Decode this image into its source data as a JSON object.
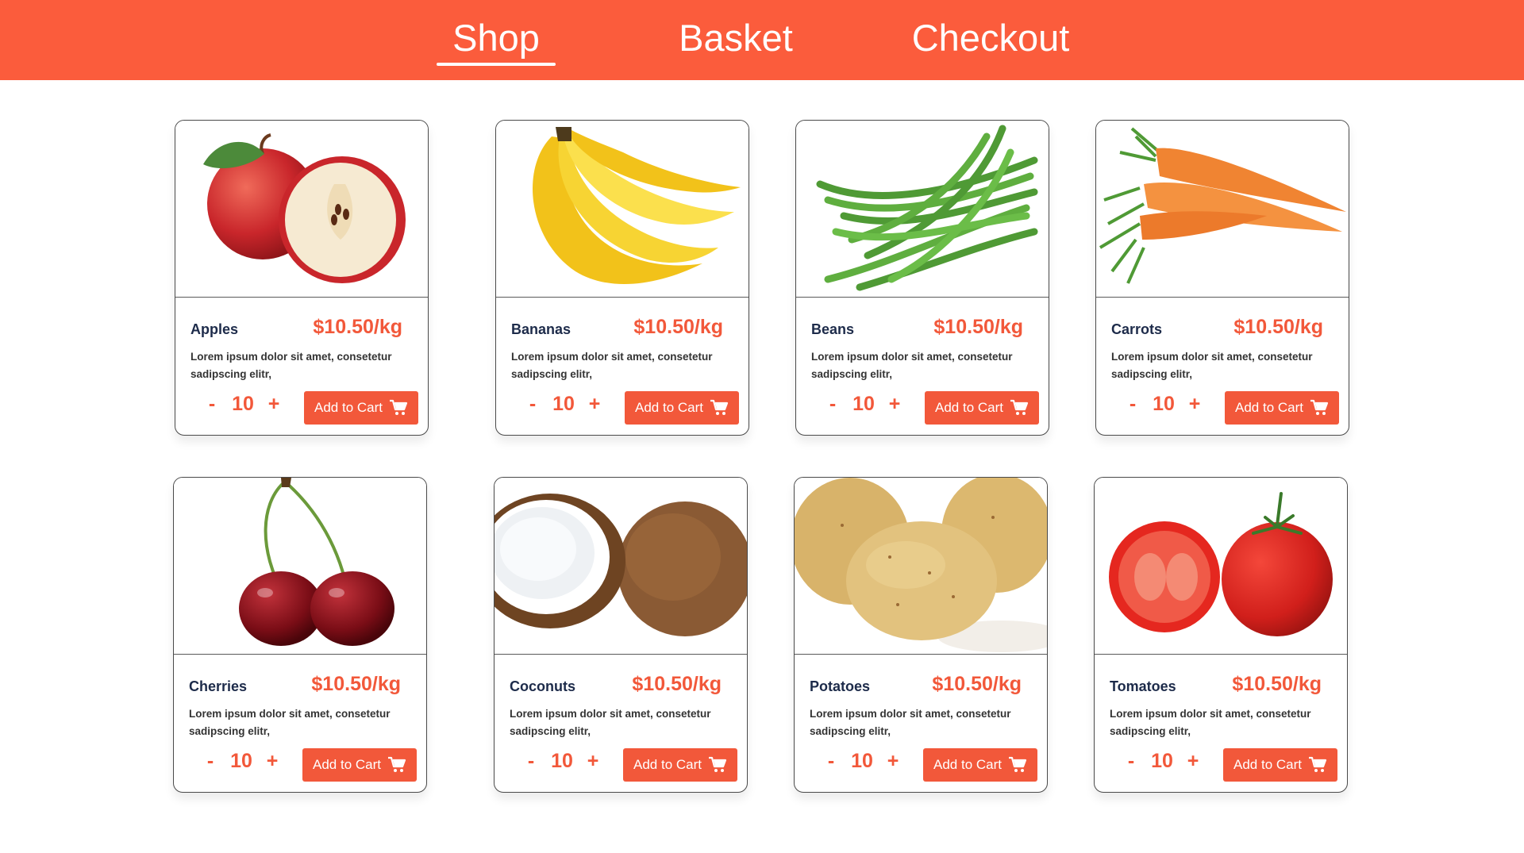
{
  "nav": {
    "shop": "Shop",
    "basket": "Basket",
    "checkout": "Checkout"
  },
  "products": [
    {
      "name": "Apples",
      "price": "$10.50/kg",
      "desc": "Lorem ipsum dolor sit amet, consetetur sadipscing elitr,",
      "qty": "10",
      "add_label": "Add to Cart"
    },
    {
      "name": "Bananas",
      "price": "$10.50/kg",
      "desc": "Lorem ipsum dolor sit amet, consetetur sadipscing elitr,",
      "qty": "10",
      "add_label": "Add to Cart"
    },
    {
      "name": "Beans",
      "price": "$10.50/kg",
      "desc": "Lorem ipsum dolor sit amet, consetetur sadipscing elitr,",
      "qty": "10",
      "add_label": "Add to Cart"
    },
    {
      "name": "Carrots",
      "price": "$10.50/kg",
      "desc": "Lorem ipsum dolor sit amet, consetetur sadipscing elitr,",
      "qty": "10",
      "add_label": "Add to Cart"
    },
    {
      "name": "Cherries",
      "price": "$10.50/kg",
      "desc": "Lorem ipsum dolor sit amet, consetetur sadipscing elitr,",
      "qty": "10",
      "add_label": "Add to Cart"
    },
    {
      "name": "Coconuts",
      "price": "$10.50/kg",
      "desc": "Lorem ipsum dolor sit amet, consetetur sadipscing elitr,",
      "qty": "10",
      "add_label": "Add to Cart"
    },
    {
      "name": "Potatoes",
      "price": "$10.50/kg",
      "desc": "Lorem ipsum dolor sit amet, consetetur sadipscing elitr,",
      "qty": "10",
      "add_label": "Add to Cart"
    },
    {
      "name": "Tomatoes",
      "price": "$10.50/kg",
      "desc": "Lorem ipsum dolor sit amet, consetetur sadipscing elitr,",
      "qty": "10",
      "add_label": "Add to Cart"
    }
  ],
  "qty_controls": {
    "minus": "-",
    "plus": "+"
  },
  "colors": {
    "brand": "#fb5c3c",
    "accent": "#f2583a",
    "title_text": "#1d2b4a"
  },
  "icons": {
    "cart": "shopping-cart-icon"
  }
}
